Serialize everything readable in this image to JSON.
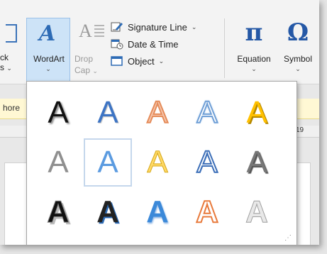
{
  "ribbon": {
    "quick_parts": {
      "label_line1": "ck",
      "label_line2": "s"
    },
    "wordart": {
      "label": "WordArt",
      "glyph": "A"
    },
    "drop_cap": {
      "glyph": "A",
      "label_line1": "Drop",
      "label_line2": "Cap"
    },
    "signature_line": {
      "label": "Signature Line"
    },
    "date_time": {
      "label": "Date & Time"
    },
    "object": {
      "label": "Object"
    },
    "equation": {
      "label": "Equation",
      "glyph": "π"
    },
    "symbol": {
      "label": "Symbol",
      "glyph": "Ω"
    }
  },
  "document": {
    "infobar_text": "hore",
    "ruler_number": "19"
  },
  "gallery": {
    "items": [
      {
        "glyph": "A",
        "style": "fill-black-shadow"
      },
      {
        "glyph": "A",
        "style": "fill-blue"
      },
      {
        "glyph": "A",
        "style": "outline-orange"
      },
      {
        "glyph": "A",
        "style": "outline-blue-glow"
      },
      {
        "glyph": "A",
        "style": "fill-gold-shadow"
      },
      {
        "glyph": "A",
        "style": "fill-gray"
      },
      {
        "glyph": "A",
        "style": "fill-blue-reflection"
      },
      {
        "glyph": "A",
        "style": "fill-light-gold"
      },
      {
        "glyph": "A",
        "style": "outline-blue"
      },
      {
        "glyph": "A",
        "style": "fill-gray-shadow"
      },
      {
        "glyph": "A",
        "style": "fill-black-bevel"
      },
      {
        "glyph": "A",
        "style": "fill-black-blue-shadow"
      },
      {
        "glyph": "A",
        "style": "fill-blue-gradient"
      },
      {
        "glyph": "A",
        "style": "outline-orange-bold"
      },
      {
        "glyph": "A",
        "style": "fill-silver"
      }
    ],
    "selected_index": 6
  },
  "colors": {
    "accent_blue": "#2d6bb5",
    "selected_bg": "#cde3f7",
    "infobar_bg": "#fff8d4"
  }
}
